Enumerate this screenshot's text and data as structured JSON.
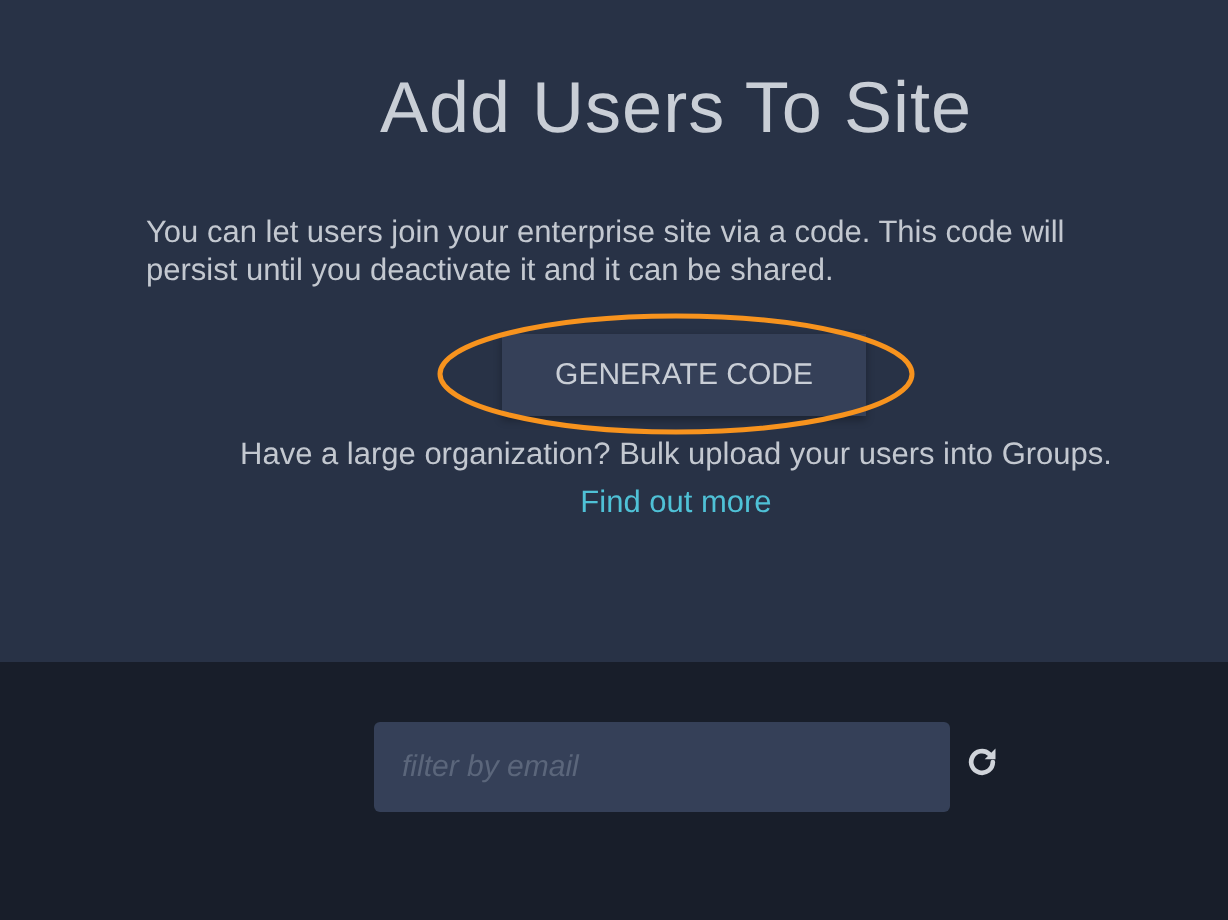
{
  "title": "Add Users To Site",
  "description": "You can let users join your enterprise site via a code. This code will persist until you deactivate it and it can be shared.",
  "generate_button": "GENERATE CODE",
  "bulk_text": "Have a large organization? Bulk upload your users into Groups.",
  "link": "Find out more",
  "filter": {
    "placeholder": "filter by email"
  }
}
